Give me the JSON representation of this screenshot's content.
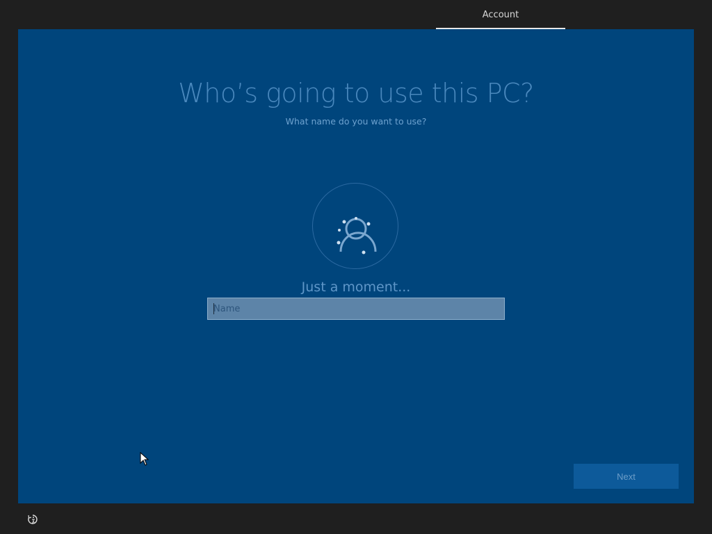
{
  "header": {
    "tabs": [
      {
        "label": "Account",
        "active": true
      }
    ]
  },
  "main": {
    "title": "Who’s going to use this PC?",
    "subtitle": "What name do you want to use?",
    "avatar_icon": "user-loading-icon",
    "status_text": "Just a moment...",
    "name_field": {
      "value": "",
      "placeholder": "Name"
    },
    "next_label": "Next"
  },
  "footer": {
    "accessibility_icon": "ease-of-access-icon"
  },
  "colors": {
    "panel_bg": "#00457c",
    "frame_bg": "#1f1f1f",
    "heading_text": "#4a88bd",
    "input_bg": "#5d84a8",
    "button_bg": "#0d5a9a"
  }
}
